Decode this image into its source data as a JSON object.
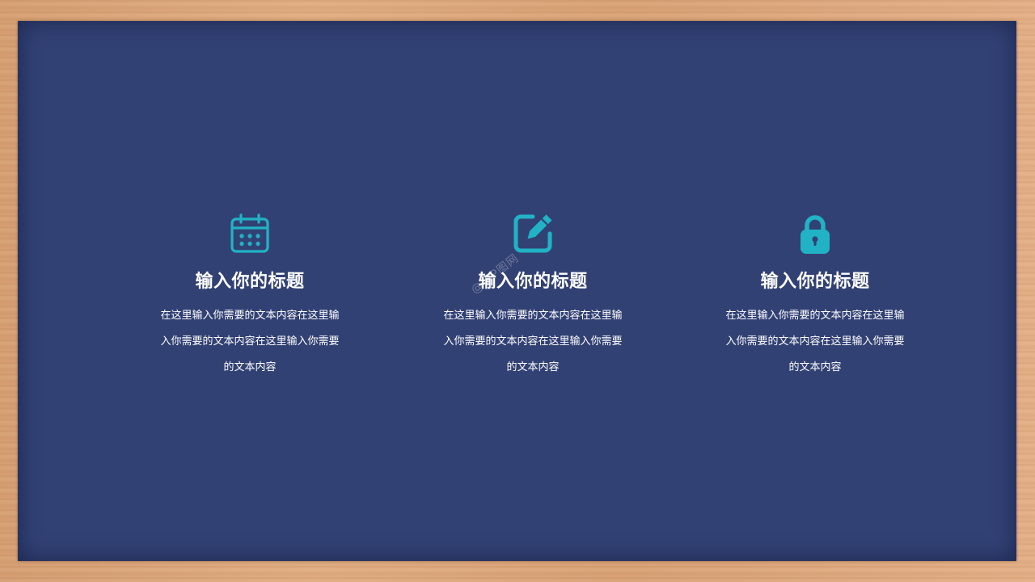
{
  "colors": {
    "board": "#324174",
    "accent": "#21b3c5",
    "text": "#ffffff",
    "frame": "#d9a277"
  },
  "features": [
    {
      "icon": "calendar-icon",
      "title": "输入你的标题",
      "description": "在这里输入你需要的文本内容在这里输入你需要的文本内容在这里输入你需要的文本内容"
    },
    {
      "icon": "edit-icon",
      "title": "输入你的标题",
      "description": "在这里输入你需要的文本内容在这里输入你需要的文本内容在这里输入你需要的文本内容"
    },
    {
      "icon": "lock-icon",
      "title": "输入你的标题",
      "description": "在这里输入你需要的文本内容在这里输入你需要的文本内容在这里输入你需要的文本内容"
    }
  ],
  "watermark": "@-PP图网"
}
